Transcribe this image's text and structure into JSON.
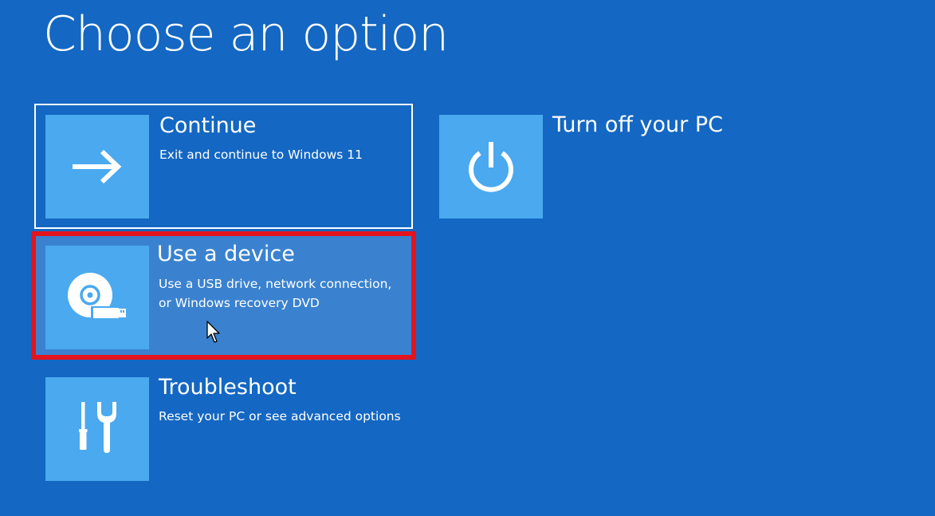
{
  "page": {
    "title": "Choose an option"
  },
  "options": {
    "continue": {
      "title": "Continue",
      "description": "Exit and continue to Windows 11",
      "icon": "arrow-right-icon"
    },
    "use_device": {
      "title": "Use a device",
      "description": "Use a USB drive, network connection, or Windows recovery DVD",
      "icon": "disc-usb-icon"
    },
    "troubleshoot": {
      "title": "Troubleshoot",
      "description": "Reset your PC or see advanced options",
      "icon": "tools-icon"
    },
    "turn_off": {
      "title": "Turn off your PC",
      "icon": "power-icon"
    }
  },
  "colors": {
    "background": "#1467c2",
    "tile": "#4aa9ef",
    "selected_background": "#3a82cf",
    "highlight_outline": "#e4141e"
  }
}
